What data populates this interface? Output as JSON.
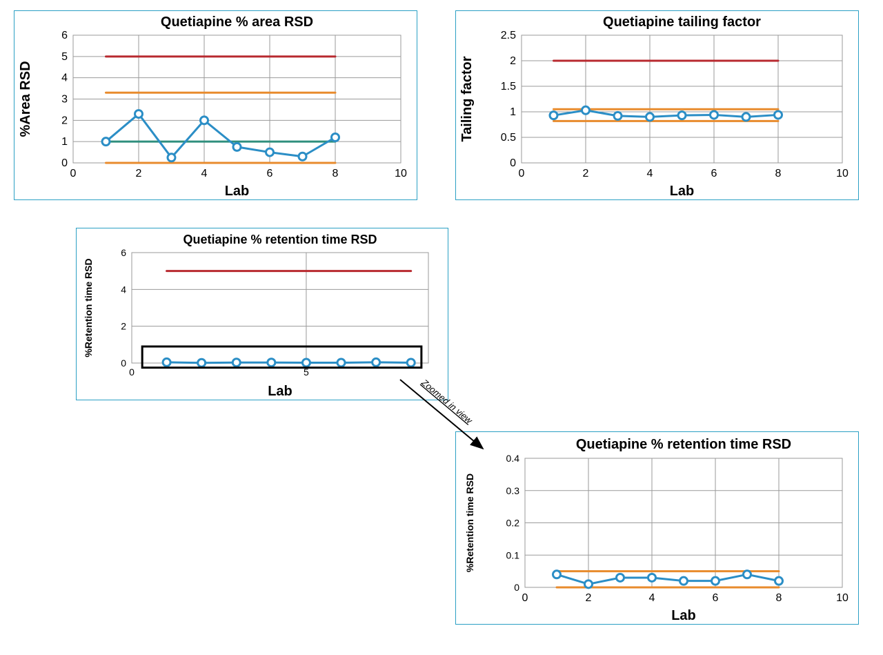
{
  "annotation": {
    "zoomed": "Zoomed in view"
  },
  "chart_data": [
    {
      "id": "area_rsd",
      "type": "line",
      "title": "Quetiapine % area RSD",
      "xlabel": "Lab",
      "ylabel": "%Area RSD",
      "xlim": [
        0,
        10
      ],
      "ylim": [
        0,
        6
      ],
      "xticks": [
        0,
        2,
        4,
        6,
        8,
        10
      ],
      "yticks": [
        0,
        1,
        2,
        3,
        4,
        5,
        6
      ],
      "x": [
        1,
        2,
        3,
        4,
        5,
        6,
        7,
        8
      ],
      "values": [
        1.0,
        2.3,
        0.25,
        2.0,
        0.75,
        0.5,
        0.3,
        1.2
      ],
      "constants": [
        {
          "color": "red",
          "value": 5.0,
          "x0": 1,
          "x1": 8
        },
        {
          "color": "orange",
          "value": 3.3,
          "x0": 1,
          "x1": 8
        },
        {
          "color": "teal",
          "value": 1.0,
          "x0": 1,
          "x1": 8
        },
        {
          "color": "orange",
          "value": 0.0,
          "x0": 1,
          "x1": 8
        }
      ]
    },
    {
      "id": "tailing",
      "type": "line",
      "title": "Quetiapine tailing factor",
      "xlabel": "Lab",
      "ylabel": "Tailing factor",
      "xlim": [
        0,
        10
      ],
      "ylim": [
        0,
        2.5
      ],
      "xticks": [
        0,
        2,
        4,
        6,
        8,
        10
      ],
      "yticks": [
        0,
        0.5,
        1,
        1.5,
        2,
        2.5
      ],
      "x": [
        1,
        2,
        3,
        4,
        5,
        6,
        7,
        8
      ],
      "values": [
        0.93,
        1.03,
        0.92,
        0.9,
        0.93,
        0.94,
        0.9,
        0.94
      ],
      "constants": [
        {
          "color": "red",
          "value": 2.0,
          "x0": 1,
          "x1": 8
        },
        {
          "color": "orange",
          "value": 1.05,
          "x0": 1,
          "x1": 8
        },
        {
          "color": "orange",
          "value": 0.82,
          "x0": 1,
          "x1": 8
        }
      ]
    },
    {
      "id": "rt_full",
      "type": "line",
      "title": "Quetiapine % retention time RSD",
      "xlabel": "Lab",
      "ylabel": "%Retention time RSD",
      "xlim": [
        0,
        8.5
      ],
      "ylim": [
        0,
        6
      ],
      "xticks": [
        0,
        5
      ],
      "yticks": [
        0,
        2,
        4,
        6
      ],
      "x": [
        1,
        2,
        3,
        4,
        5,
        6,
        7,
        8
      ],
      "values": [
        0.04,
        0.01,
        0.03,
        0.03,
        0.02,
        0.02,
        0.04,
        0.02
      ],
      "constants": [
        {
          "color": "red",
          "value": 5.0,
          "x0": 1,
          "x1": 8
        }
      ],
      "zoom_box": {
        "x0": 0.3,
        "x1": 8.3,
        "y0": -0.25,
        "y1": 0.9
      }
    },
    {
      "id": "rt_zoom",
      "type": "line",
      "title": "Quetiapine % retention time RSD",
      "xlabel": "Lab",
      "ylabel": "%Retention time RSD",
      "xlim": [
        0,
        10
      ],
      "ylim": [
        0,
        0.4
      ],
      "xticks": [
        0,
        2,
        4,
        6,
        8,
        10
      ],
      "yticks": [
        0,
        0.1,
        0.2,
        0.3,
        0.4
      ],
      "x": [
        1,
        2,
        3,
        4,
        5,
        6,
        7,
        8
      ],
      "values": [
        0.04,
        0.01,
        0.03,
        0.03,
        0.02,
        0.02,
        0.04,
        0.02
      ],
      "constants": [
        {
          "color": "orange",
          "value": 0.05,
          "x0": 1,
          "x1": 8
        },
        {
          "color": "orange",
          "value": 0.0,
          "x0": 1,
          "x1": 8
        }
      ]
    }
  ]
}
